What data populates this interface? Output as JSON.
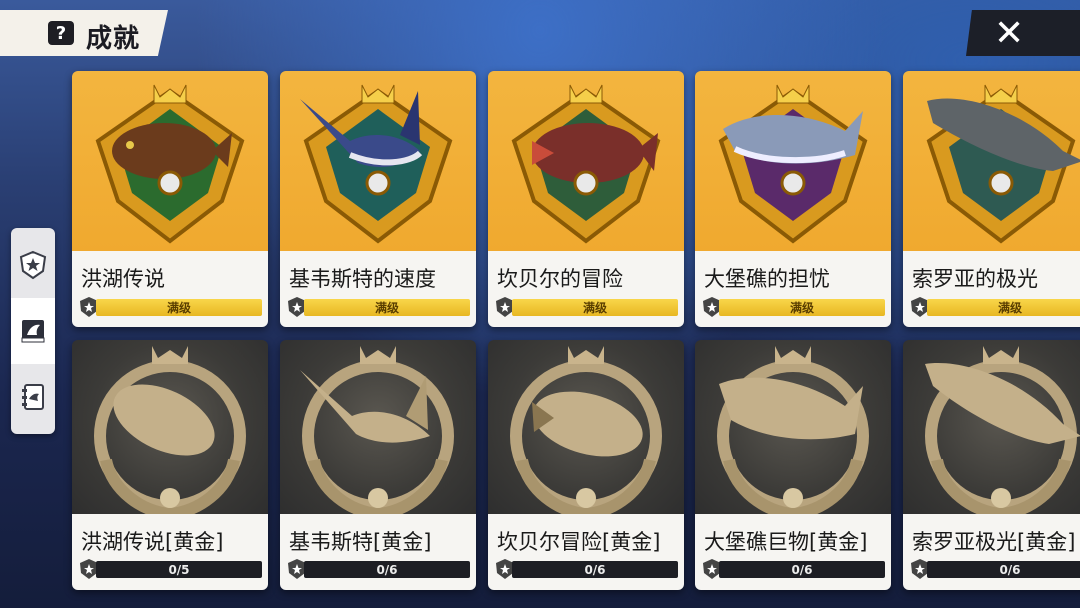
{
  "header": {
    "title": "成就",
    "help_icon": "?",
    "close_icon": "✕"
  },
  "side_nav": [
    {
      "name": "trophy-shield-icon",
      "active": false
    },
    {
      "name": "fish-book-icon",
      "active": true
    },
    {
      "name": "notebook-icon",
      "active": false
    }
  ],
  "row1": [
    {
      "name": "洪湖传说",
      "status": "满级",
      "fish": "carp-fish-icon",
      "fish_color": "#6b3b1c"
    },
    {
      "name": "基韦斯特的速度",
      "status": "满级",
      "fish": "marlin-fish-icon",
      "fish_color": "#3a4a8a"
    },
    {
      "name": "坎贝尔的冒险",
      "status": "满级",
      "fish": "grouper-fish-icon",
      "fish_color": "#7a2f2a"
    },
    {
      "name": "大堡礁的担忧",
      "status": "满级",
      "fish": "shark-fish-icon",
      "fish_color": "#8a9ab8"
    },
    {
      "name": "索罗亚的极光",
      "status": "满级",
      "fish": "gray-shark-icon",
      "fish_color": "#5e6468"
    }
  ],
  "row2": [
    {
      "name": "洪湖传说[黄金]",
      "progress": "0/5",
      "fish": "carp-medal-icon"
    },
    {
      "name": "基韦斯特[黄金]",
      "progress": "0/6",
      "fish": "marlin-medal-icon"
    },
    {
      "name": "坎贝尔冒险[黄金]",
      "progress": "0/6",
      "fish": "grouper-medal-icon"
    },
    {
      "name": "大堡礁巨物[黄金]",
      "progress": "0/6",
      "fish": "shark-medal-icon"
    },
    {
      "name": "索罗亚极光[黄金]",
      "progress": "0/6",
      "fish": "gray-shark-medal-icon"
    }
  ],
  "colors": {
    "gold_card": "#f0a92f",
    "bronze_card": "#3c3b38",
    "bar_gold": "#e8b722",
    "bar_dark": "#1d1e24"
  }
}
